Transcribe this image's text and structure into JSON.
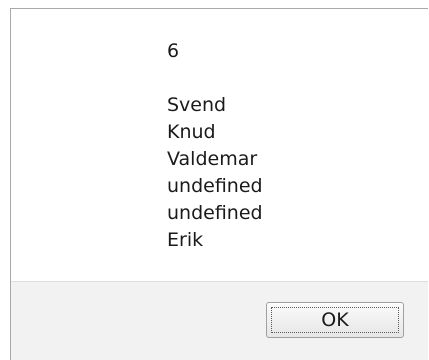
{
  "dialog": {
    "message_lines": [
      "6",
      "",
      "Svend",
      "Knud",
      "Valdemar",
      "undefined",
      "undefined",
      "Erik"
    ],
    "ok_label": "OK"
  }
}
